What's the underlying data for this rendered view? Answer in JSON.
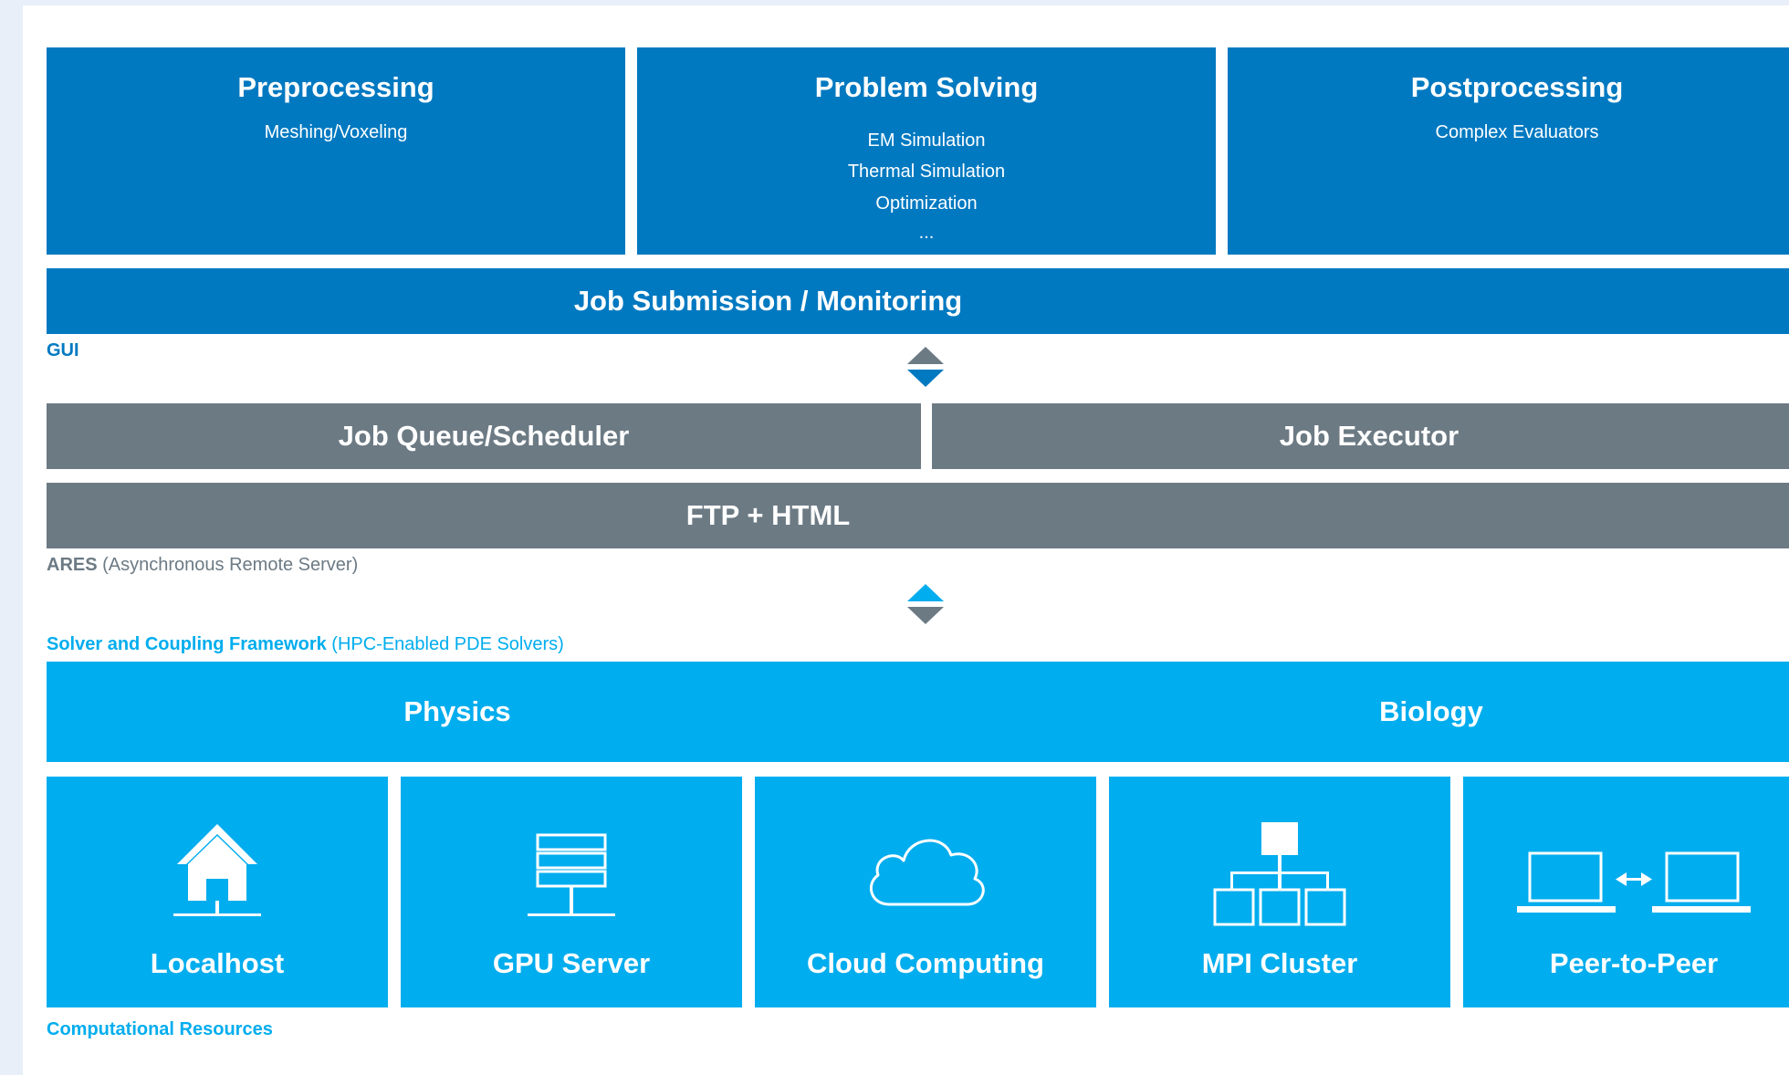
{
  "gui": {
    "modules": [
      {
        "title": "Preprocessing",
        "items": [
          "Meshing/Voxeling"
        ]
      },
      {
        "title": "Problem Solving",
        "items": [
          "EM Simulation",
          "Thermal Simulation",
          "Optimization",
          "..."
        ]
      },
      {
        "title": "Postprocessing",
        "items": [
          "Complex Evaluators"
        ]
      }
    ],
    "job_bar": "Job Submission / Monitoring",
    "label": "GUI"
  },
  "ares": {
    "queue": "Job Queue/Scheduler",
    "executor": "Job Executor",
    "ftp": "FTP + HTML",
    "label_bold": "ARES",
    "label_rest": "(Asynchronous Remote Server)"
  },
  "solver": {
    "label_bold": "Solver and Coupling Framework",
    "label_rest": "(HPC-Enabled PDE Solvers)",
    "physics": "Physics",
    "biology": "Biology"
  },
  "resources": {
    "items": [
      {
        "name": "Localhost",
        "icon": "house-icon"
      },
      {
        "name": "GPU Server",
        "icon": "server-icon"
      },
      {
        "name": "Cloud  Computing",
        "icon": "cloud-icon"
      },
      {
        "name": "MPI Cluster",
        "icon": "network-icon"
      },
      {
        "name": "Peer-to-Peer",
        "icon": "laptops-icon"
      }
    ],
    "label": "Computational Resources"
  },
  "colors": {
    "dark_blue": "#0079c1",
    "gray": "#6c7a84",
    "cyan": "#00adee",
    "background": "#e9eff8"
  }
}
